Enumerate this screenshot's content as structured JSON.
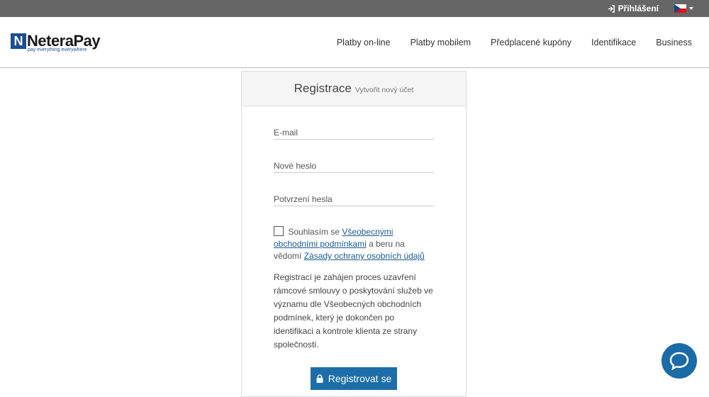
{
  "topbar": {
    "login_label": "Přihlášení",
    "icons": {
      "login": "sign-in-icon",
      "flag": "czech-flag-icon"
    }
  },
  "header": {
    "logo_text": "NeteraPay",
    "logo_tagline": "pay everything everywhere",
    "nav": [
      {
        "label": "Platby on-line"
      },
      {
        "label": "Platby mobilem"
      },
      {
        "label": "Předplacené kupóny"
      },
      {
        "label": "Identifikace"
      },
      {
        "label": "Business"
      }
    ]
  },
  "card": {
    "title": "Registrace",
    "subtitle": "Vytvořit nový účet",
    "fields": {
      "email_placeholder": "E-mail",
      "password_placeholder": "Nové heslo",
      "confirm_placeholder": "Potvrzení hesla"
    },
    "consent": {
      "prefix": "Souhlasím se",
      "terms_link": "Všeobecnými obchodními podmínkami",
      "middle": "a beru na vědomí",
      "privacy_link": "Zásady ochrany osobních údajů"
    },
    "info": "Registrací je zahájen proces uzavření rámcové smlouvy o poskytování služeb ve významu dle Všeobecných obchodních podmínek, který je dokončen po identifikaci a kontrole klienta ze strany společnosti.",
    "submit_label": "Registrovat se"
  },
  "colors": {
    "topbar": "#666666",
    "primary": "#1d6ea8",
    "link": "#1a5b8f"
  }
}
